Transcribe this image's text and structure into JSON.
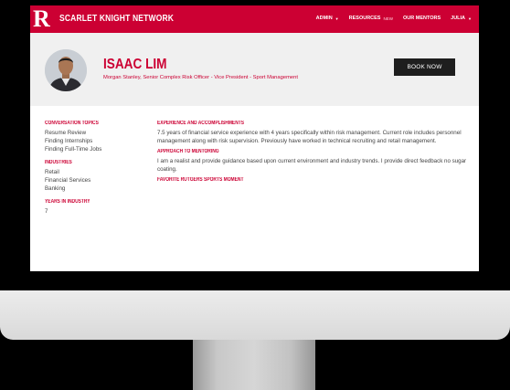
{
  "nav": {
    "brand": "SCARLET KNIGHT NETWORK",
    "logo_letter": "R",
    "links": [
      {
        "label": "ADMIN",
        "has_caret": true
      },
      {
        "label": "RESOURCES",
        "badge": "NEW"
      },
      {
        "label": "OUR MENTORS"
      },
      {
        "label": "JULIA",
        "has_caret": true
      }
    ]
  },
  "profile": {
    "name": "ISAAC LIM",
    "subtitle": "Morgan Stanley, Senior Complex Risk Officer - Vice President - Sport Management",
    "book_button": "BOOK NOW"
  },
  "sidebar": {
    "conversation_title": "CONVERSATION TOPICS",
    "conversation_items": [
      "Resume Review",
      "Finding Internships",
      "Finding Full-Time Jobs"
    ],
    "industries_title": "INDUSTRIES",
    "industries_items": [
      "Retail",
      "Financial Services",
      "Banking"
    ],
    "years_title": "YEARS IN INDUSTRY",
    "years_value": "7"
  },
  "main": {
    "experience_title": "EXPERIENCE AND ACCOMPLISHMENTS",
    "experience_text": "7.5 years of financial service experience with 4 years specifically within risk management. Current role includes personnel management along with risk supervision. Previously have worked in technical recruiting and retail management.",
    "approach_title": "APPROACH TO MENTORING",
    "approach_text": "I am a realist and provide guidance based upon current environment and industry trends. I provide direct feedback no sugar coating.",
    "moment_title": "FAVORITE RUTGERS SPORTS MOMENT"
  },
  "colors": {
    "accent": "#cc0033",
    "button": "#1e1e1e",
    "header_bg": "#f0f0f0"
  }
}
